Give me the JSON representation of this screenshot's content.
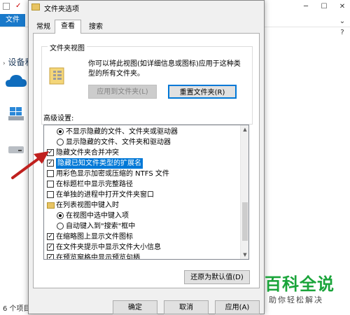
{
  "background": {
    "ribbon": {
      "file_tab": "文件"
    },
    "sidebar": {
      "section_label": "设备和"
    },
    "status": {
      "item_count": "6 个项目"
    }
  },
  "dialog": {
    "title": "文件夹选项",
    "tabs": [
      {
        "label": "常规",
        "active": false
      },
      {
        "label": "查看",
        "active": true
      },
      {
        "label": "搜索",
        "active": false
      }
    ],
    "folder_view": {
      "group_title": "文件夹视图",
      "description": "你可以将此视图(如详细信息或图标)应用于这种类型的所有文件夹。",
      "apply_button": "应用到文件夹(L)",
      "reset_button": "重置文件夹(R)"
    },
    "advanced": {
      "label": "高级设置:",
      "items": [
        {
          "type": "radio",
          "checked": true,
          "indent": 1,
          "label": "不显示隐藏的文件、文件夹或驱动器"
        },
        {
          "type": "radio",
          "checked": false,
          "indent": 1,
          "label": "显示隐藏的文件、文件夹和驱动器"
        },
        {
          "type": "checkbox",
          "checked": true,
          "indent": 0,
          "label": "隐藏文件夹合并冲突"
        },
        {
          "type": "checkbox",
          "checked": true,
          "indent": 0,
          "label": "隐藏已知文件类型的扩展名",
          "highlighted": true
        },
        {
          "type": "checkbox",
          "checked": false,
          "indent": 0,
          "label": "用彩色显示加密或压缩的 NTFS 文件"
        },
        {
          "type": "checkbox",
          "checked": false,
          "indent": 0,
          "label": "在标题栏中显示完整路径"
        },
        {
          "type": "checkbox",
          "checked": false,
          "indent": 0,
          "label": "在单独的进程中打开文件夹窗口"
        },
        {
          "type": "folder",
          "checked": false,
          "indent": 0,
          "label": "在列表视图中键入时"
        },
        {
          "type": "radio",
          "checked": true,
          "indent": 1,
          "label": "在视图中选中键入项"
        },
        {
          "type": "radio",
          "checked": false,
          "indent": 1,
          "label": "自动键入到\"搜索\"框中"
        },
        {
          "type": "checkbox",
          "checked": true,
          "indent": 0,
          "label": "在缩略图上显示文件图标"
        },
        {
          "type": "checkbox",
          "checked": true,
          "indent": 0,
          "label": "在文件夹提示中显示文件大小信息"
        },
        {
          "type": "checkbox",
          "checked": true,
          "indent": 0,
          "label": "在预览窗格中显示预览句柄"
        }
      ],
      "restore_button": "还原为默认值(D)"
    },
    "buttons": {
      "ok": "确定",
      "cancel": "取消",
      "apply": "应用(A)"
    }
  },
  "watermark": {
    "title": "百科全说",
    "subtitle": "助你轻松解决"
  },
  "colors": {
    "accent": "#0078d7",
    "arrow": "#c0201e",
    "watermark": "#1aa43a"
  }
}
